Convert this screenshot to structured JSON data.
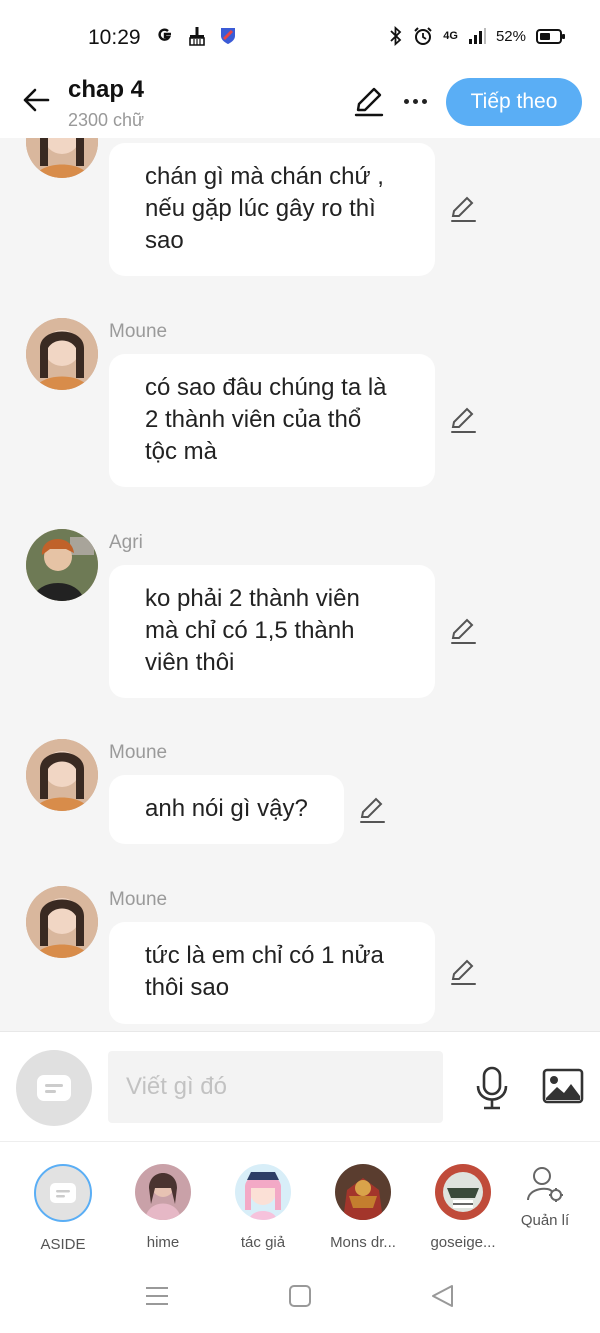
{
  "status_bar": {
    "time": "10:29",
    "network": "4G",
    "battery": "52%"
  },
  "header": {
    "title": "chap 4",
    "subtitle": "2300 chữ",
    "next_label": "Tiếp theo"
  },
  "messages": [
    {
      "sender": "",
      "text": "chán gì mà chán chứ , nếu gặp lúc gây ro thì sao"
    },
    {
      "sender": "Moune",
      "text": "có sao đâu chúng ta là 2 thành viên của thổ tộc mà"
    },
    {
      "sender": "Agri",
      "text": "ko phải 2 thành viên mà chỉ có 1,5 thành viên thôi"
    },
    {
      "sender": "Moune",
      "text": "anh nói gì vậy?"
    },
    {
      "sender": "Moune",
      "text": "tức là em chỉ có 1 nửa thôi sao"
    }
  ],
  "composer": {
    "placeholder": "Viết gì đó"
  },
  "characters": [
    {
      "label": "ASIDE"
    },
    {
      "label": "hime"
    },
    {
      "label": "tác giả"
    },
    {
      "label": "Mons dr..."
    },
    {
      "label": "goseige..."
    },
    {
      "label": "Quản lí"
    }
  ],
  "colors": {
    "accent": "#5aaef5",
    "background": "#f5f5f5",
    "bubble": "#ffffff"
  }
}
